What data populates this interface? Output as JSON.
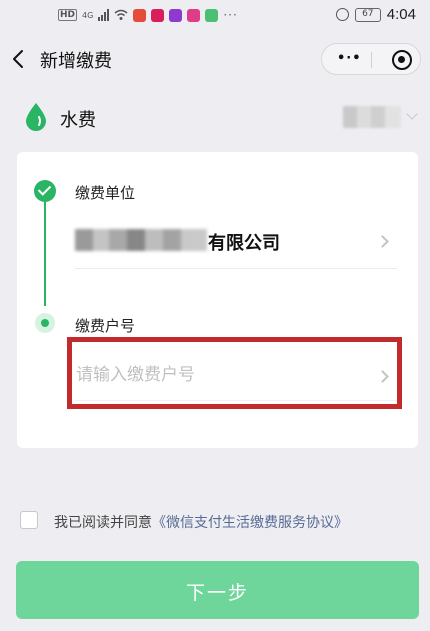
{
  "status_bar": {
    "network_badge": "HD",
    "network_type": "4G",
    "more": "···",
    "battery": "67",
    "time": "4:04"
  },
  "nav": {
    "title": "新增缴费",
    "more_label": "•·•"
  },
  "service": {
    "name": "水费"
  },
  "form": {
    "unit_label": "缴费单位",
    "unit_value": "有限公司",
    "account_label": "缴费户号",
    "account_placeholder": "请输入缴费户号",
    "account_value": ""
  },
  "agreement": {
    "prefix": "我已阅读并同意",
    "link": "《微信支付生活缴费服务协议》",
    "checked": false
  },
  "next_button": {
    "label": "下一步"
  },
  "colors": {
    "accent_green": "#2ab564",
    "button_green_disabled": "#6ed69a",
    "link_blue": "#576b95",
    "highlight_red": "#c22a2c"
  }
}
